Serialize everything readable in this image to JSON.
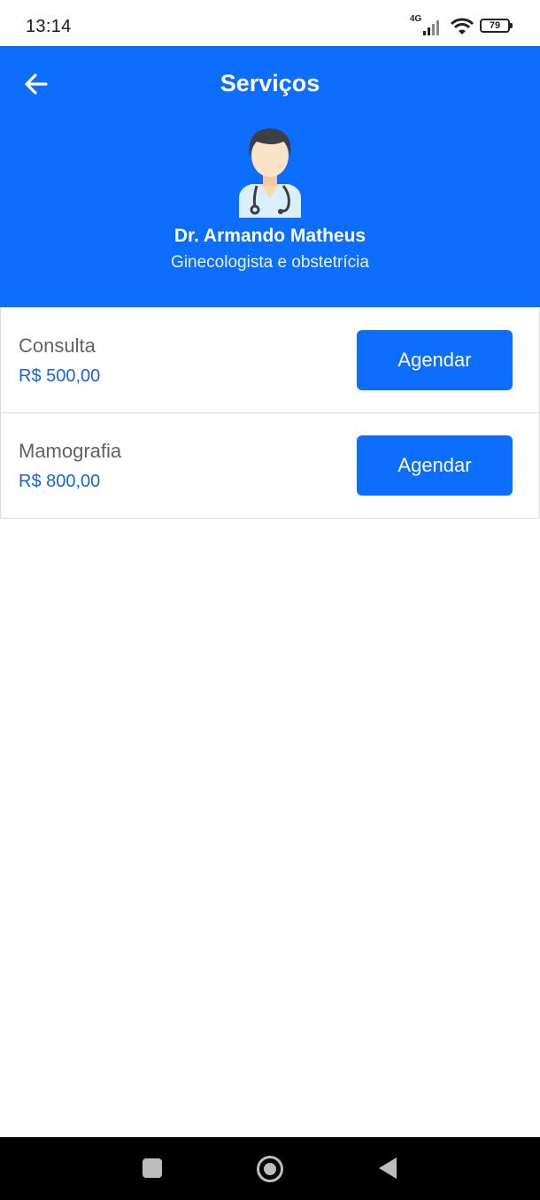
{
  "status_bar": {
    "time": "13:14",
    "network": "4G",
    "battery": "79",
    "icons": [
      "signal-icon",
      "wifi-icon",
      "battery-icon"
    ]
  },
  "header": {
    "title": "Serviços",
    "back_icon": "arrow-left-icon",
    "avatar_icon": "doctor-avatar-icon",
    "doctor_name": "Dr. Armando Matheus",
    "specialty": "Ginecologista e obstetrícia"
  },
  "services": [
    {
      "name": "Consulta",
      "price": "R$ 500,00",
      "button_label": "Agendar"
    },
    {
      "name": "Mamografia",
      "price": "R$ 800,00",
      "button_label": "Agendar"
    }
  ],
  "nav": {
    "icons": [
      "recent-apps-icon",
      "home-icon",
      "back-icon"
    ]
  },
  "colors": {
    "primary": "#0d6efd",
    "price": "#1565d8",
    "text_muted": "#5f6368",
    "nav_bar": "#000000"
  }
}
